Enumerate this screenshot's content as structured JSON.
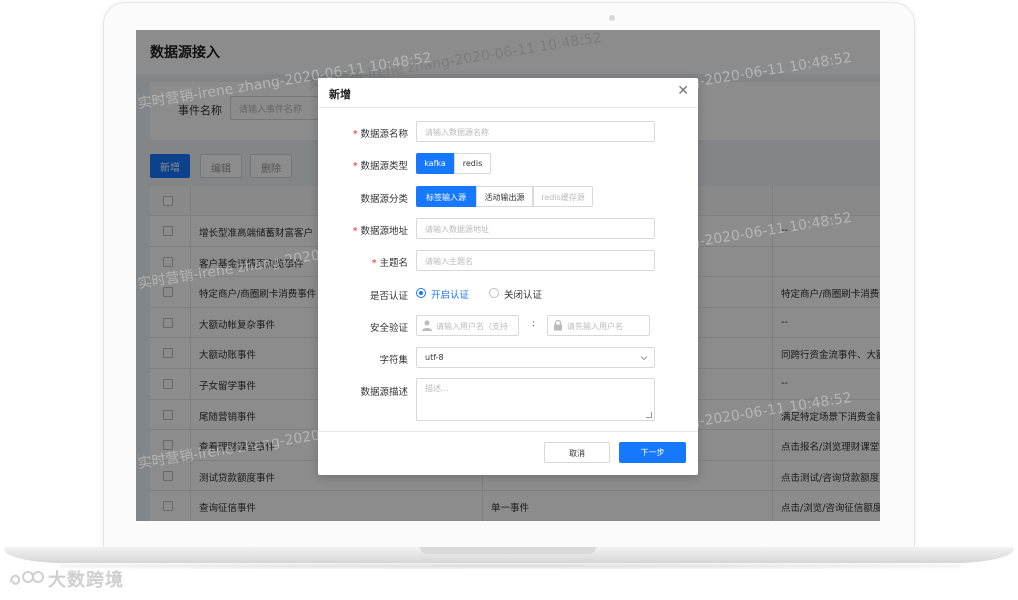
{
  "page": {
    "title": "数据源接入",
    "filter_label": "事件名称",
    "filter_placeholder": "请输入事件名称",
    "buttons": {
      "new": "新增",
      "edit": "编辑",
      "delete": "删除"
    }
  },
  "table": {
    "rows": [
      {
        "name": "增长型准高端储蓄财富客户",
        "type": "",
        "desc": "--"
      },
      {
        "name": "客户基金详情页浏览事件",
        "type": "",
        "desc": ""
      },
      {
        "name": "特定商户/商圈刷卡消费事件",
        "type": "",
        "desc": "特定商户/商圈刷卡消费事"
      },
      {
        "name": "大额动帐复杂事件",
        "type": "",
        "desc": "--"
      },
      {
        "name": "大额动账事件",
        "type": "",
        "desc": "同跨行资金流事件、大额"
      },
      {
        "name": "子女留学事件",
        "type": "",
        "desc": "--"
      },
      {
        "name": "尾随营销事件",
        "type": "",
        "desc": "满足特定场景下消费金额"
      },
      {
        "name": "查看理财课堂事件",
        "type": "",
        "desc": "点击报名/浏览理财课堂事"
      },
      {
        "name": "测试贷款额度事件",
        "type": "",
        "desc": "点击测试/咨询贷款额度事"
      },
      {
        "name": "查询征信事件",
        "type": "单一事件",
        "desc": "点击/浏览/咨询征信额度事"
      }
    ]
  },
  "watermark": "实时营销-irene zhang-2020-06-11 10:48:52",
  "modal": {
    "title": "新增",
    "fields": {
      "name_label": "数据源名称",
      "name_placeholder": "请输入数据源名称",
      "type_label": "数据源类型",
      "type_options": [
        "kafka",
        "redis"
      ],
      "type_selected": "kafka",
      "category_label": "数据源分类",
      "category_options": [
        "标签输入源",
        "活动输出源",
        "redis缓存源"
      ],
      "category_selected": "标签输入源",
      "address_label": "数据源地址",
      "address_placeholder": "请输入数据源地址",
      "topic_label": "主题名",
      "topic_placeholder": "请输入主题名",
      "auth_label": "是否认证",
      "auth_on": "开启认证",
      "auth_off": "关闭认证",
      "security_label": "安全验证",
      "user_placeholder": "请输入用户名（支持",
      "password_placeholder": "请先输入用户名",
      "charset_label": "字符集",
      "charset_value": "utf-8",
      "desc_label": "数据源描述",
      "desc_placeholder": "描述..."
    },
    "cancel": "取消",
    "next": "下一步"
  },
  "brand": {
    "name": "大数跨境"
  },
  "colors": {
    "primary": "#1677ff",
    "required": "#f5222d"
  }
}
